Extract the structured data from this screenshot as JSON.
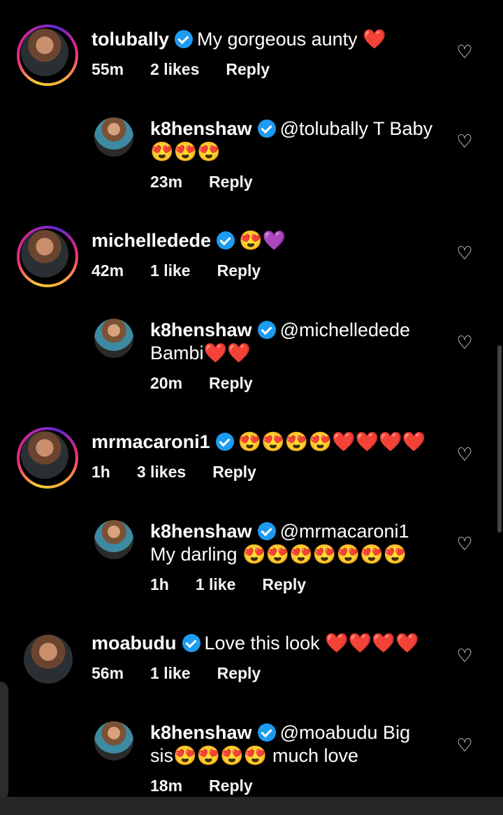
{
  "comments": [
    {
      "username": "tolubally",
      "text": "My gorgeous aunty ❤️",
      "time": "55m",
      "likes": "2 likes",
      "reply": "Reply",
      "reply_comment": {
        "username": "k8henshaw",
        "text1": "@tolubally T Baby",
        "text2": "😍😍😍",
        "time": "23m",
        "likes": "",
        "reply": "Reply"
      }
    },
    {
      "username": "michelledede",
      "text": "😍💜",
      "time": "42m",
      "likes": "1 like",
      "reply": "Reply",
      "reply_comment": {
        "username": "k8henshaw",
        "text1": "@michelledede",
        "text2": "Bambi❤️❤️",
        "time": "20m",
        "likes": "",
        "reply": "Reply"
      }
    },
    {
      "username": "mrmacaroni1",
      "text": "😍😍😍😍❤️❤️❤️❤️",
      "time": "1h",
      "likes": "3 likes",
      "reply": "Reply",
      "reply_comment": {
        "username": "k8henshaw",
        "text1": "@mrmacaroni1",
        "text2": "My darling 😍😍😍😍😍😍😍",
        "time": "1h",
        "likes": "1 like",
        "reply": "Reply"
      }
    },
    {
      "username": "moabudu",
      "text": "Love this look ❤️❤️❤️❤️",
      "time": "56m",
      "likes": "1 like",
      "reply": "Reply",
      "reply_comment": {
        "username": "k8henshaw",
        "text1": "@moabudu Big",
        "text2": "sis😍😍😍😍 much love",
        "time": "18m",
        "likes": "",
        "reply": "Reply"
      }
    }
  ],
  "icons": {
    "like": "heart-outline-icon",
    "verified": "verified-badge-icon"
  },
  "colors": {
    "background": "#000000",
    "verified": "#1d9bf0"
  }
}
